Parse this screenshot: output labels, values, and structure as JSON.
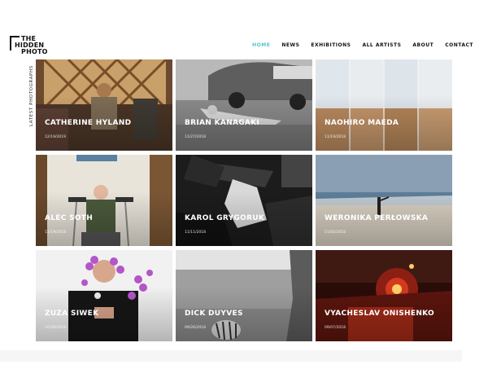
{
  "header": {
    "logo": {
      "line1": "THE",
      "line2": "HIDDEN",
      "line3": "PHOTO"
    },
    "nav": [
      {
        "label": "HOME",
        "active": true
      },
      {
        "label": "NEWS"
      },
      {
        "label": "EXHIBITIONS"
      },
      {
        "label": "ALL ARTISTS"
      },
      {
        "label": "ABOUT"
      },
      {
        "label": "CONTACT"
      }
    ],
    "accent_color": "#57c3d0"
  },
  "section_label": "LATEST PHOTOGRAPHS",
  "tiles": [
    {
      "name": "CATHERINE HYLAND",
      "date": "12/19/2019"
    },
    {
      "name": "BRIAN KANAGAKI",
      "date": "11/27/2018"
    },
    {
      "name": "NAOHIRO MAEDA",
      "date": "11/19/2018"
    },
    {
      "name": "ALEC SOTH",
      "date": "11/19/2018"
    },
    {
      "name": "KAROL GRYGORUK",
      "date": "11/11/2018"
    },
    {
      "name": "WERONIKA PERŁOWSKA",
      "date": "11/02/2018"
    },
    {
      "name": "ZUZA SIWEK",
      "date": "10/30/2018"
    },
    {
      "name": "DICK DUYVES",
      "date": "09/26/2018"
    },
    {
      "name": "VYACHESLAV ONISHENKO",
      "date": "09/07/2018"
    }
  ]
}
